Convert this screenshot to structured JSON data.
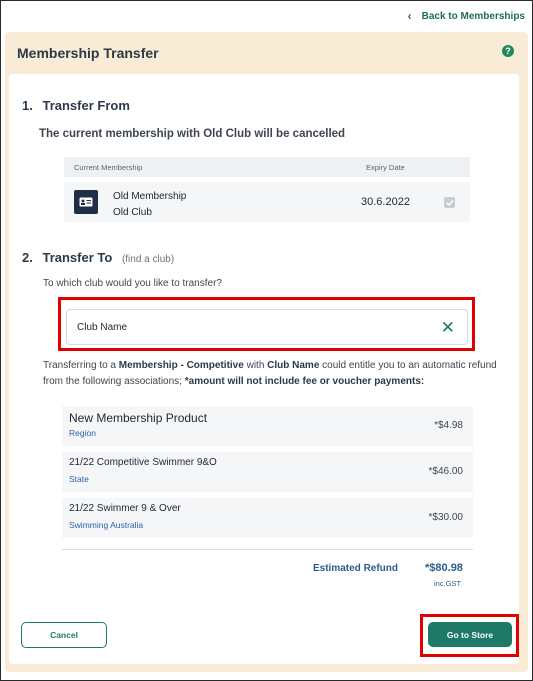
{
  "nav": {
    "back_label": "Back to Memberships"
  },
  "header": {
    "title": "Membership Transfer"
  },
  "transfer_from": {
    "number": "1.",
    "heading": "Transfer From",
    "note": "The current membership with Old Club will be cancelled",
    "columns": {
      "current": "Current Membership",
      "expiry": "Expiry Date"
    },
    "row": {
      "name": "Old Membership",
      "club": "Old Club",
      "expiry": "30.6.2022"
    }
  },
  "transfer_to": {
    "number": "2.",
    "heading": "Transfer To",
    "hint": "(find a club)",
    "question": "To which club would you like to transfer?",
    "club_value": "Club Name",
    "info_prefix": "Transferring to a ",
    "info_membership": "Membership - Competitive",
    "info_with": " with ",
    "info_club": "Club Name",
    "info_mid": " could entitle you to an automatic refund from the following associations; ",
    "info_note": "*amount will not include fee or voucher payments:"
  },
  "refunds": [
    {
      "name": "New Membership Product",
      "association": "Region",
      "amount": "*$4.98"
    },
    {
      "name": "21/22 Competitive Swimmer 9&O",
      "association": "State",
      "amount": "*$46.00"
    },
    {
      "name": "21/22 Swimmer 9 & Over",
      "association": "Swimming Australia",
      "amount": "*$30.00"
    }
  ],
  "estimate": {
    "label": "Estimated Refund",
    "value": "*$80.98",
    "gst": "inc.GST"
  },
  "actions": {
    "cancel_label": "Cancel",
    "store_label": "Go to Store"
  },
  "colors": {
    "accent": "#1d7a68",
    "panel": "#f9ecd6",
    "highlight": "#e10000",
    "link": "#2b5d8f"
  },
  "icons": {
    "back": "chevron-left-icon",
    "help": "question-icon",
    "membership": "id-card-icon",
    "check": "check-icon",
    "clear": "close-icon"
  }
}
